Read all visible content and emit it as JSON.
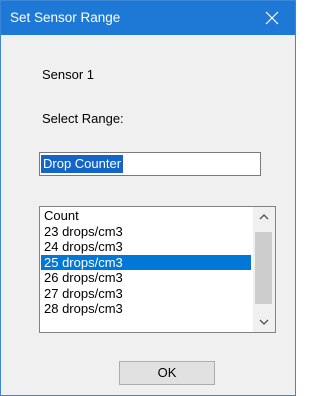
{
  "window": {
    "title": "Set Sensor Range",
    "close_label": "×"
  },
  "sensor_label": "Sensor 1",
  "range_label": "Select Range:",
  "name_field": {
    "value": "Drop Counter"
  },
  "range_list": {
    "items": [
      "Count",
      "23 drops/cm3",
      "24 drops/cm3",
      "25 drops/cm3",
      "26 drops/cm3",
      "27 drops/cm3",
      "28 drops/cm3"
    ],
    "selected_item": "25 drops/cm3"
  },
  "ok_button": {
    "label": "OK"
  },
  "colors": {
    "titlebar": "#1e78d6",
    "selection": "#0078d7",
    "dialog_background": "#f0f0f0"
  }
}
